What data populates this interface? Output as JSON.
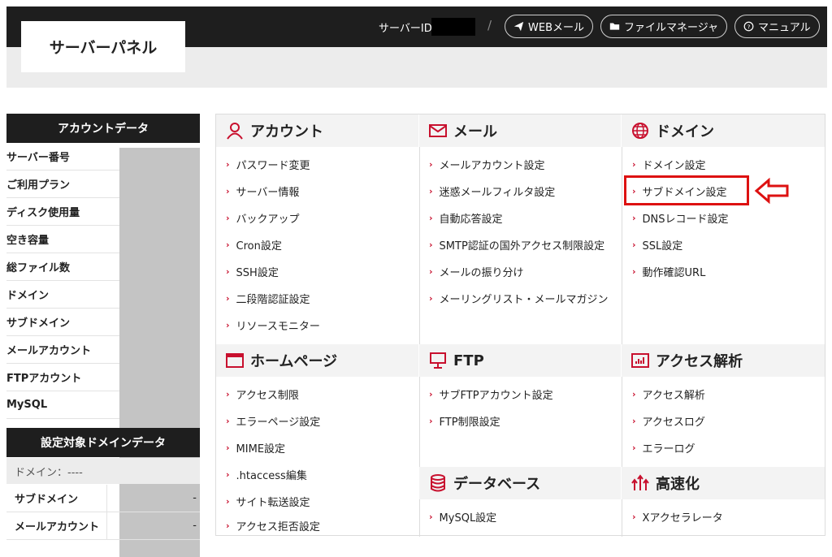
{
  "header": {
    "logo": "サーバーパネル",
    "server_id_label": "サーバーID",
    "separator": "/",
    "buttons": [
      {
        "label": "WEBメール",
        "icon": "paper-plane-icon"
      },
      {
        "label": "ファイルマネージャ",
        "icon": "folder-icon"
      },
      {
        "label": "マニュアル",
        "icon": "question-circle-icon"
      }
    ]
  },
  "sidebar": {
    "account_title": "アカウントデータ",
    "account_rows": [
      "サーバー番号",
      "ご利用プラン",
      "ディスク使用量",
      "空き容量",
      "総ファイル数",
      "ドメイン",
      "サブドメイン",
      "メールアカウント",
      "FTPアカウント",
      "MySQL"
    ],
    "domain_title": "設定対象ドメインデータ",
    "domain_label": "ドメイン：----",
    "domain_rows": [
      {
        "label": "サブドメイン",
        "value": "-"
      },
      {
        "label": "メールアカウント",
        "value": "-"
      }
    ]
  },
  "sections": {
    "account": {
      "title": "アカウント",
      "icon": "user-icon",
      "items": [
        "パスワード変更",
        "サーバー情報",
        "バックアップ",
        "Cron設定",
        "SSH設定",
        "二段階認証設定",
        "リソースモニター"
      ]
    },
    "mail": {
      "title": "メール",
      "icon": "envelope-icon",
      "items": [
        "メールアカウント設定",
        "迷惑メールフィルタ設定",
        "自動応答設定",
        "SMTP認証の国外アクセス制限設定",
        "メールの振り分け",
        "メーリングリスト・メールマガジン"
      ]
    },
    "domain": {
      "title": "ドメイン",
      "icon": "globe-icon",
      "items": [
        "ドメイン設定",
        "サブドメイン設定",
        "DNSレコード設定",
        "SSL設定",
        "動作確認URL"
      ]
    },
    "homepage": {
      "title": "ホームページ",
      "icon": "browser-window-icon",
      "items": [
        "アクセス制限",
        "エラーページ設定",
        "MIME設定",
        ".htaccess編集",
        "サイト転送設定",
        "アクセス拒否設定"
      ]
    },
    "ftp": {
      "title": "FTP",
      "icon": "monitor-icon",
      "items": [
        "サブFTPアカウント設定",
        "FTP制限設定"
      ]
    },
    "analytics": {
      "title": "アクセス解析",
      "icon": "bar-chart-icon",
      "items": [
        "アクセス解析",
        "アクセスログ",
        "エラーログ"
      ]
    },
    "database": {
      "title": "データベース",
      "icon": "database-icon",
      "items": [
        "MySQL設定"
      ]
    },
    "speed": {
      "title": "高速化",
      "icon": "speed-arrows-icon",
      "items": [
        "Xアクセラレータ"
      ]
    }
  },
  "colors": {
    "accent": "#c8102e",
    "dark": "#1e1e1e",
    "highlight": "#dd1111"
  }
}
